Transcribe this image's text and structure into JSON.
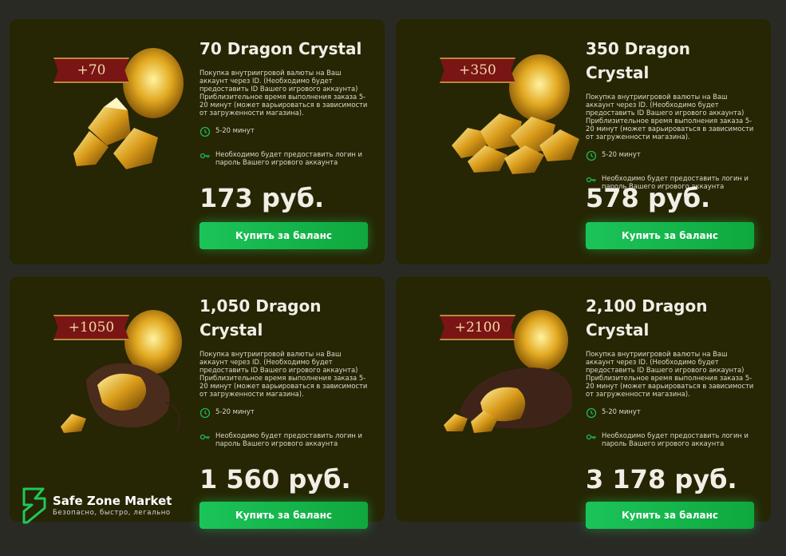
{
  "colors": {
    "card_bg": "#262504",
    "page_bg": "#2a2a25",
    "accent_green": "#1bc45a",
    "badge_red": "#7a1515"
  },
  "products": [
    {
      "badge": "+70",
      "title": "70 Dragon Crystal",
      "description": "Покупка внутриигровой валюты на Ваш аккаунт через ID. (Необходимо будет предоставить ID Вашего игрового аккаунта) Приблизительное время выполнения заказа 5-20 минут (может варьироваться в зависимости от загруженности магазина).",
      "time": "5-20 минут",
      "requirement": "Необходимо будет предоставить логин и пароль Вашего игрового аккаунта",
      "price": "173 руб.",
      "button": "Купить за баланс",
      "image_icon": "crystal-shards-icon"
    },
    {
      "badge": "+350",
      "title": "350 Dragon Crystal",
      "description": "Покупка внутриигровой валюты на Ваш аккаунт через ID. (Необходимо будет предоставить ID Вашего игрового аккаунта) Приблизительное время выполнения заказа 5-20 минут (может варьироваться в зависимости от загруженности магазина).",
      "time": "5-20 минут",
      "requirement": "Необходимо будет предоставить логин и пароль Вашего игрового аккаунта",
      "price": "578 руб.",
      "button": "Купить за баланс",
      "image_icon": "crystal-pile-icon"
    },
    {
      "badge": "+1050",
      "title": "1,050 Dragon Crystal",
      "description": "Покупка внутриигровой валюты на Ваш аккаунт через ID. (Необходимо будет предоставить ID Вашего игрового аккаунта) Приблизительное время выполнения заказа 5-20 минут (может варьироваться в зависимости от загруженности магазина).",
      "time": "5-20 минут",
      "requirement": "Необходимо будет предоставить логин и пароль Вашего игрового аккаунта",
      "price": "1 560 руб.",
      "button": "Купить за баланс",
      "image_icon": "crystal-bag-icon"
    },
    {
      "badge": "+2100",
      "title": "2,100 Dragon Crystal",
      "description": "Покупка внутриигровой валюты на Ваш аккаунт через ID. (Необходимо будет предоставить ID Вашего игрового аккаунта) Приблизительное время выполнения заказа 5-20 минут (может варьироваться в зависимости от загруженности магазина).",
      "time": "5-20 минут",
      "requirement": "Необходимо будет предоставить логин и пароль Вашего игрового аккаунта",
      "price": "3 178 руб.",
      "button": "Купить за баланс",
      "image_icon": "crystal-sack-icon"
    }
  ],
  "logo": {
    "name": "Safe Zone Market",
    "tagline": "Безопасно, быстро, легально"
  }
}
